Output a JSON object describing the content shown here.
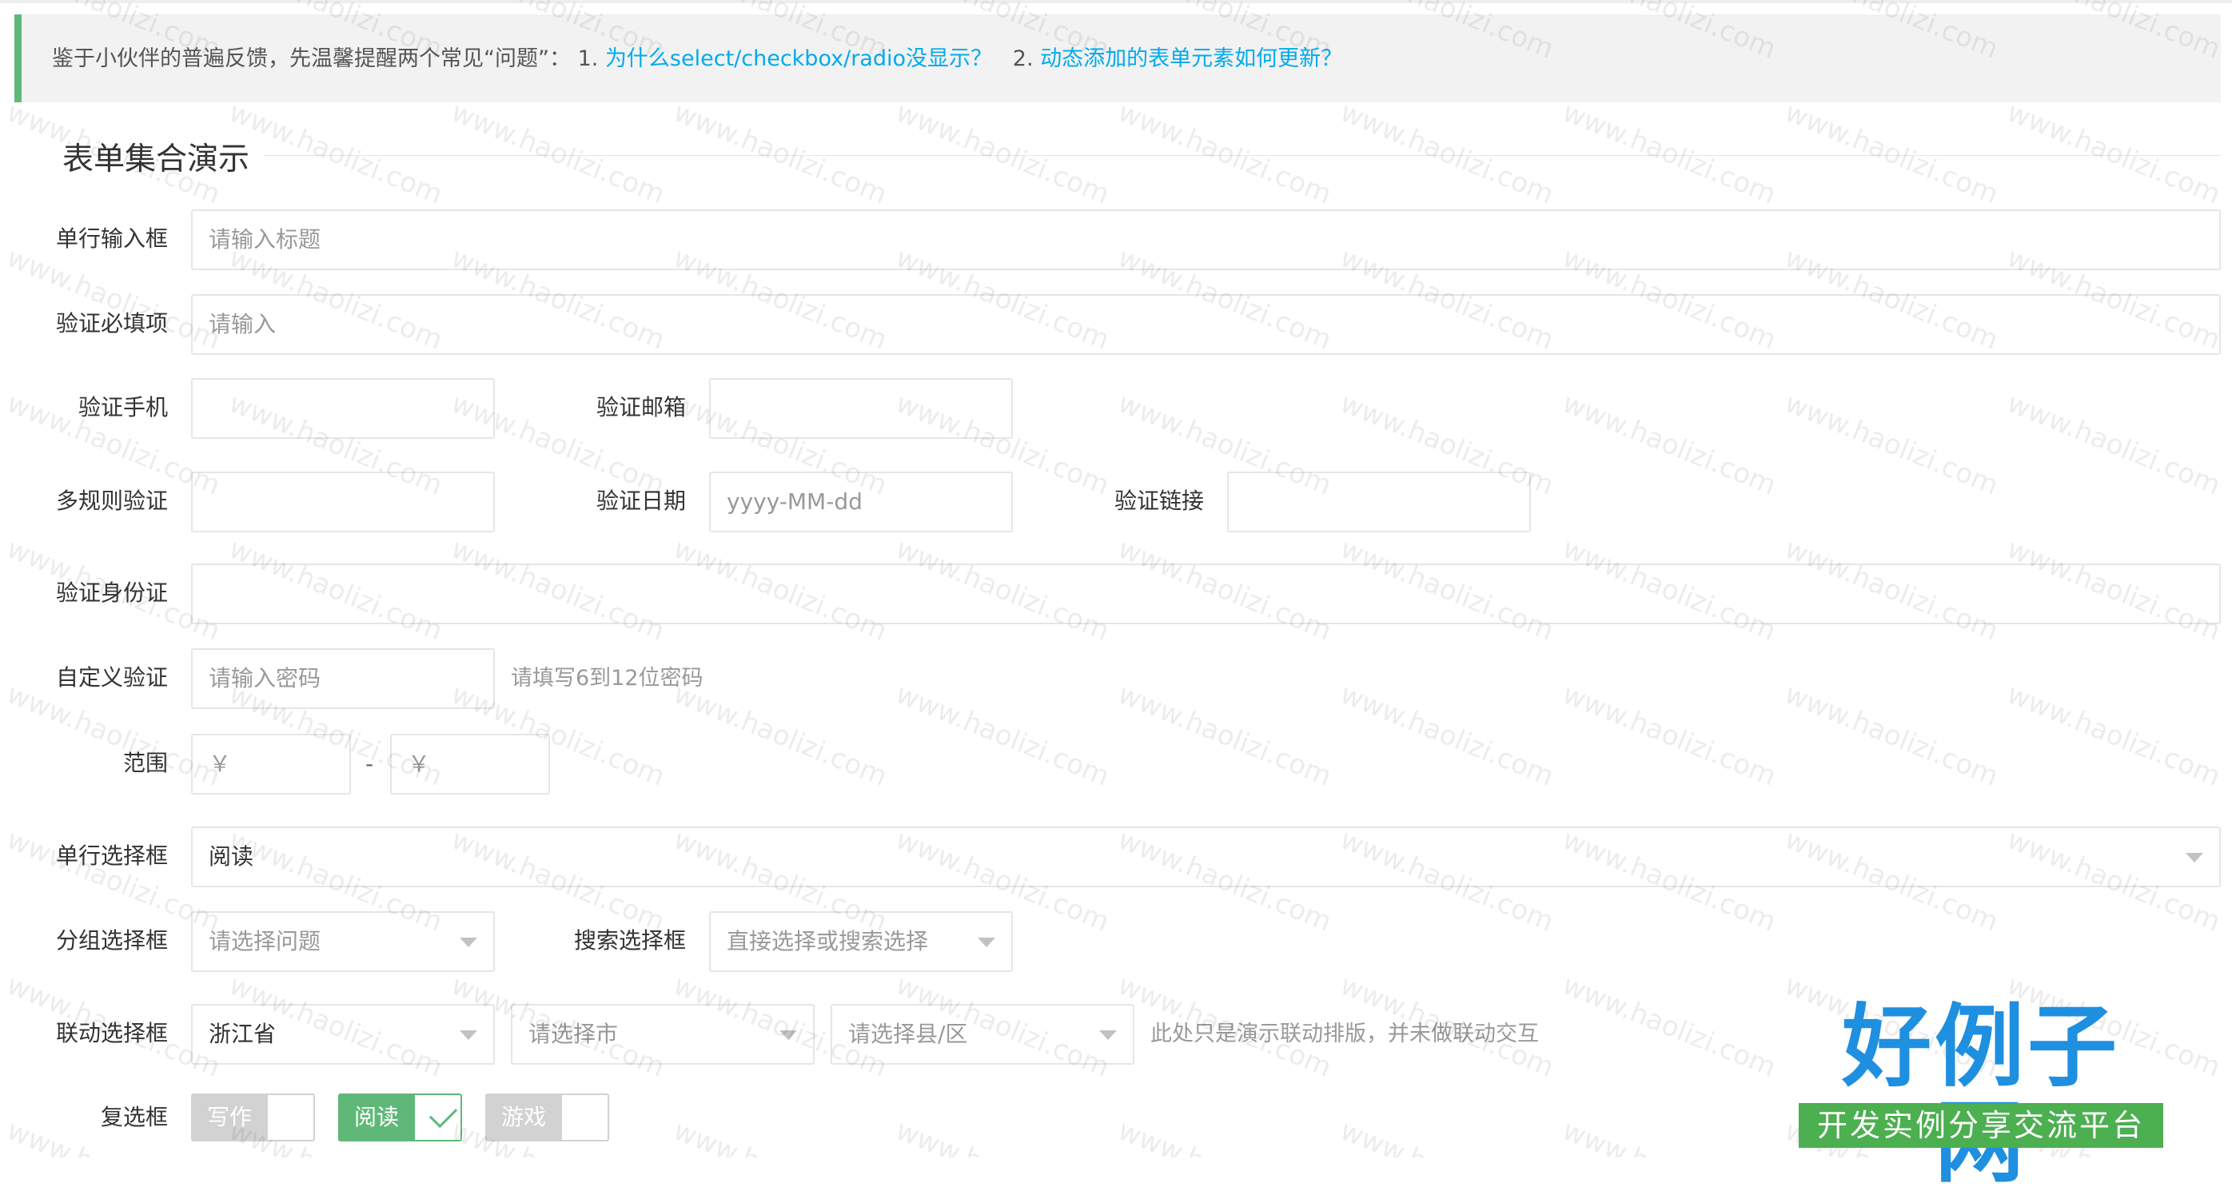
{
  "tip": {
    "prefix": "鉴于小伙伴的普遍反馈，先温馨提醒两个常见“问题”：",
    "num1": "1.",
    "link1": "为什么select/checkbox/radio没显示？",
    "num2": "2.",
    "link2": "动态添加的表单元素如何更新？"
  },
  "legend": "表单集合演示",
  "form": {
    "single_line": {
      "label": "单行输入框",
      "placeholder": "请输入标题"
    },
    "required": {
      "label": "验证必填项",
      "placeholder": "请输入"
    },
    "phone": {
      "label": "验证手机",
      "value": ""
    },
    "email": {
      "label": "验证邮箱",
      "value": ""
    },
    "multi_rule": {
      "label": "多规则验证",
      "value": ""
    },
    "date": {
      "label": "验证日期",
      "placeholder": "yyyy-MM-dd"
    },
    "url": {
      "label": "验证链接",
      "value": ""
    },
    "idcard": {
      "label": "验证身份证",
      "value": ""
    },
    "custom": {
      "label": "自定义验证",
      "placeholder": "请输入密码",
      "aux": "请填写6到12位密码"
    },
    "range": {
      "label": "范围",
      "min_placeholder": "￥",
      "max_placeholder": "￥",
      "separator": "-"
    },
    "select_single": {
      "label": "单行选择框",
      "value": "阅读"
    },
    "select_group": {
      "label": "分组选择框",
      "placeholder": "请选择问题"
    },
    "select_search": {
      "label": "搜索选择框",
      "placeholder": "直接选择或搜索选择"
    },
    "linkage": {
      "label": "联动选择框",
      "province": "浙江省",
      "city": "请选择市",
      "county": "请选择县/区",
      "aux": "此处只是演示联动排版，并未做联动交互"
    },
    "checkbox": {
      "label": "复选框",
      "items": [
        {
          "label": "写作",
          "checked": false
        },
        {
          "label": "阅读",
          "checked": true
        },
        {
          "label": "游戏",
          "checked": false
        }
      ]
    }
  },
  "watermark": "www.haolizi.com",
  "logo": {
    "main": "好例子网",
    "sub": "开发实例分享交流平台"
  },
  "colors": {
    "accent": "#5FB878",
    "link": "#01AAED",
    "logo_blue": "#1f8fe0",
    "logo_green": "#4caf50"
  }
}
